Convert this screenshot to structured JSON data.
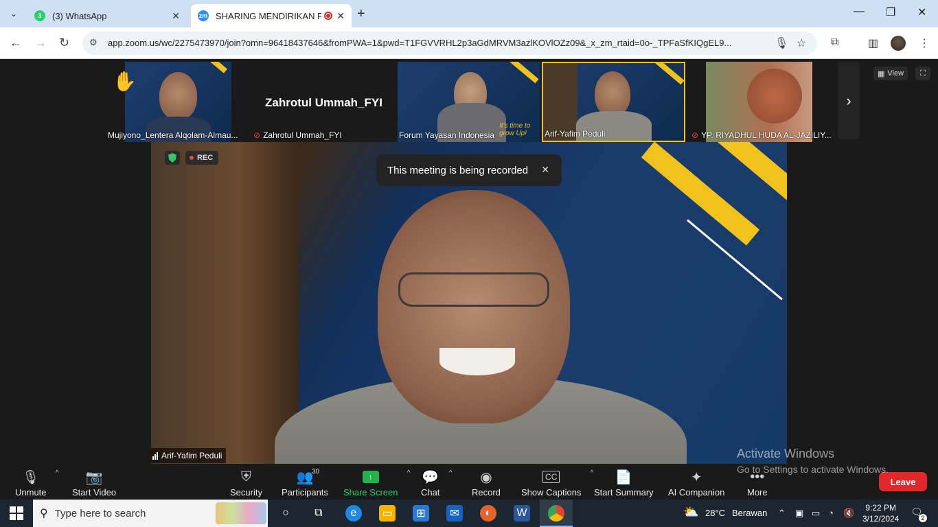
{
  "browser": {
    "tabs": [
      {
        "title": "(3) WhatsApp",
        "badge": "3",
        "active": false
      },
      {
        "title": "SHARING MENDIRIKAN RUMAH",
        "favicon": "zm",
        "active": true
      }
    ],
    "url": "app.zoom.us/wc/2275473970/join?omn=96418437646&fromPWA=1&pwd=T1FGVVRHL2p3aGdMRVM3azlKOVlOZz09&_x_zm_rtaid=0o-_TPFaSfKIQgEL9..."
  },
  "zoom": {
    "participants_strip": [
      {
        "name": "Mujiyono_Lentera Alqolam-Almau...",
        "hand_raised": true,
        "muted": false
      },
      {
        "name": "Zahrotul Ummah_FYI",
        "display": "Zahrotul Ummah_FYI",
        "muted": true,
        "video_off": true
      },
      {
        "name": "Forum Yayasan Indonesia",
        "muted": false,
        "overlay_text": "It's time to grow Up!"
      },
      {
        "name": "Arif-Yafim Peduli",
        "muted": false,
        "active_speaker": true
      },
      {
        "name": "YP. RIYADHUL HUDA AL-JAZILIY...",
        "muted": true
      }
    ],
    "view_label": "View",
    "rec_label": "REC",
    "toast": "This meeting is being recorded",
    "active_speaker_name": "Arif-Yafim Peduli",
    "controls": {
      "unmute": "Unmute",
      "start_video": "Start Video",
      "security": "Security",
      "participants": "Participants",
      "participants_count": "30",
      "share_screen": "Share Screen",
      "chat": "Chat",
      "record": "Record",
      "show_captions": "Show Captions",
      "start_summary": "Start Summary",
      "ai_companion": "AI Companion",
      "more": "More",
      "leave": "Leave"
    },
    "watermark": {
      "line1": "Activate Windows",
      "line2": "Go to Settings to activate Windows."
    }
  },
  "taskbar": {
    "search_placeholder": "Type here to search",
    "weather_temp": "28°C",
    "weather_desc": "Berawan",
    "time": "9:22 PM",
    "date": "3/12/2024",
    "notification_count": "2"
  },
  "colors": {
    "leave": "#e02828",
    "share_green": "#22b14c",
    "active_border": "#f1c21b",
    "tabstrip": "#cfe0f5"
  }
}
